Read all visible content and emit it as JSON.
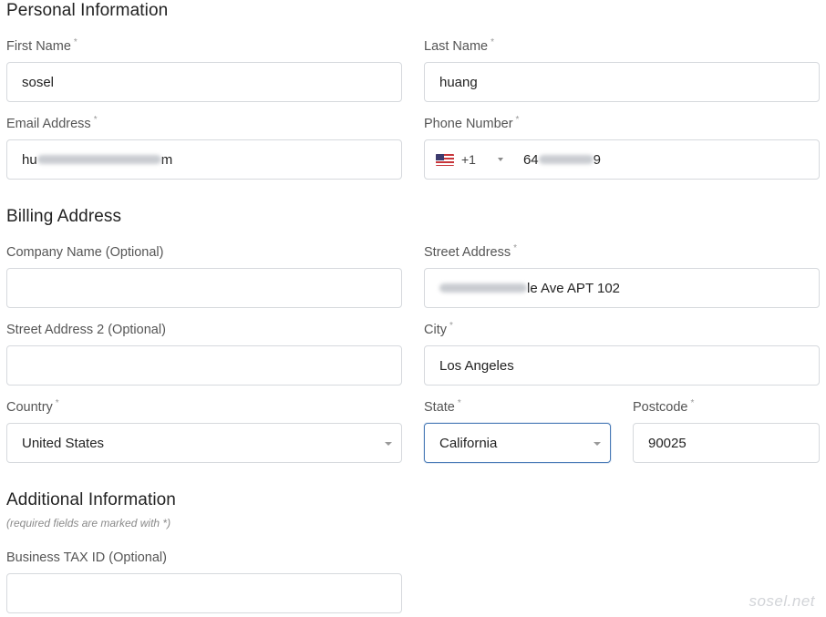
{
  "sections": {
    "personal": "Personal Information",
    "billing": "Billing Address",
    "additional": "Additional Information"
  },
  "required_marker": "*",
  "hint": "(required fields are marked with *)",
  "fields": {
    "first_name": {
      "label": "First Name",
      "value": "sosel"
    },
    "last_name": {
      "label": "Last Name",
      "value": "huang"
    },
    "email": {
      "label": "Email Address",
      "value_start": "hu",
      "value_end": "m"
    },
    "phone": {
      "label": "Phone Number",
      "dial_code": "+1",
      "value_start": "64",
      "value_end": "9"
    },
    "company": {
      "label": "Company Name (Optional)",
      "value": ""
    },
    "street": {
      "label": "Street Address",
      "value_end": "le Ave APT 102"
    },
    "street2": {
      "label": "Street Address 2 (Optional)",
      "value": ""
    },
    "city": {
      "label": "City",
      "value": "Los Angeles"
    },
    "country": {
      "label": "Country",
      "value": "United States"
    },
    "state": {
      "label": "State",
      "value": "California"
    },
    "postcode": {
      "label": "Postcode",
      "value": "90025"
    },
    "tax_id": {
      "label": "Business TAX ID (Optional)",
      "value": ""
    }
  },
  "watermark": "sosel.net",
  "colors": {
    "focus_border": "#4a7bb7",
    "field_border": "#d6d9dd",
    "label": "#555555"
  }
}
